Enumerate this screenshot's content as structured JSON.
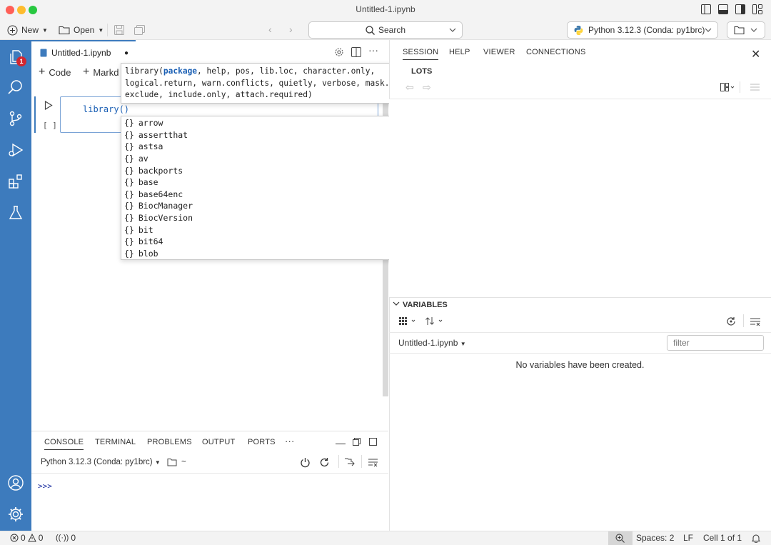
{
  "window": {
    "title": "Untitled-1.ipynb",
    "traffic_lights": [
      "#ff5f57",
      "#febc2e",
      "#28c840"
    ]
  },
  "toolbar": {
    "new_label": "New",
    "open_label": "Open",
    "search_label": "Search",
    "interpreter_label": "Python 3.12.3 (Conda: py1brc)"
  },
  "activity_bar": {
    "color": "#3d7bbd",
    "explorer_badge": "1"
  },
  "editor": {
    "tab_label": "Untitled-1.ipynb",
    "tab_modified_dot": "●",
    "add_code_label": "Code",
    "add_markdown_label": "Markd",
    "cell_code": "library()",
    "cell_exec_count": "[ ]"
  },
  "signature_help": {
    "fn": "library(",
    "active_param": "package",
    "rest": ", help, pos, lib.loc, character.only, logical.return, warn.conflicts, quietly, verbose, mask.ok, exclude, include.only, attach.required)"
  },
  "suggestions": [
    {
      "icon": "{}",
      "label": "arrow"
    },
    {
      "icon": "{}",
      "label": "assertthat"
    },
    {
      "icon": "{}",
      "label": "astsa"
    },
    {
      "icon": "{}",
      "label": "av"
    },
    {
      "icon": "{}",
      "label": "backports"
    },
    {
      "icon": "{}",
      "label": "base"
    },
    {
      "icon": "{}",
      "label": "base64enc"
    },
    {
      "icon": "{}",
      "label": "BiocManager"
    },
    {
      "icon": "{}",
      "label": "BiocVersion"
    },
    {
      "icon": "{}",
      "label": "bit"
    },
    {
      "icon": "{}",
      "label": "bit64"
    },
    {
      "icon": "{}",
      "label": "blob"
    }
  ],
  "panel": {
    "tabs": [
      "CONSOLE",
      "TERMINAL",
      "PROBLEMS",
      "OUTPUT",
      "PORTS"
    ],
    "more": "···",
    "console_session": "Python 3.12.3 (Conda: py1brc)",
    "console_dir": "~",
    "prompt": ">>>"
  },
  "right_pane": {
    "tabs": [
      "SESSION",
      "HELP",
      "VIEWER",
      "CONNECTIONS"
    ],
    "plots_title": "PLOTS",
    "plots_title_visible": "LOTS",
    "variables_title": "VARIABLES",
    "variables_session": "Untitled-1.ipynb",
    "filter_placeholder": "filter",
    "empty_message": "No variables have been created."
  },
  "status_bar": {
    "errors": "0",
    "warnings": "0",
    "ports": "0",
    "spaces": "Spaces: 2",
    "eol": "LF",
    "cell_pos": "Cell 1 of 1"
  }
}
